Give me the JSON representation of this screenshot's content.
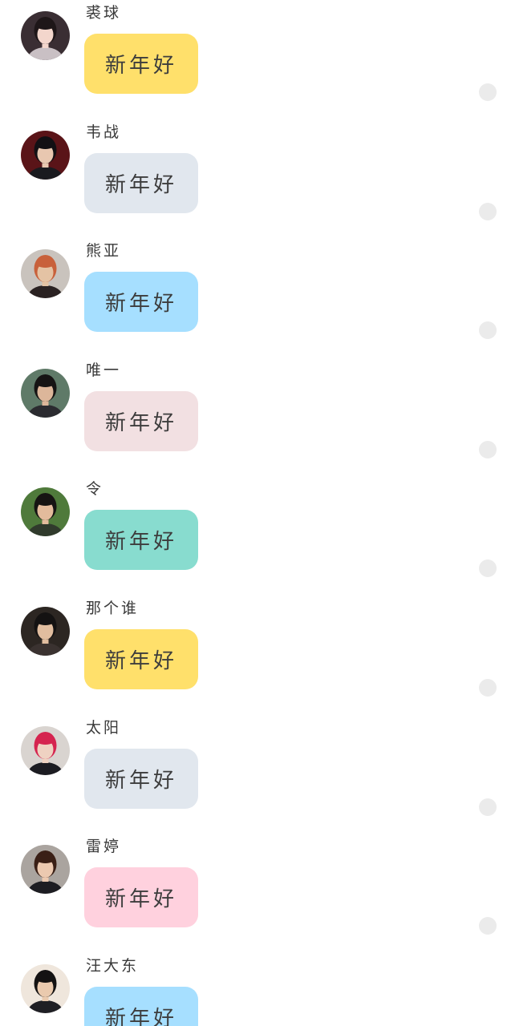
{
  "messages": [
    {
      "name": "裘球",
      "text": "新年好",
      "bubble_color": "#ffe06b",
      "avatar": {
        "bg": "#3a2e33",
        "face": "#f3d6cc",
        "hair": "#1e1618",
        "shirt": "#c9c0c4"
      }
    },
    {
      "name": "韦战",
      "text": "新年好",
      "bubble_color": "#e1e7ee",
      "avatar": {
        "bg": "#5a1418",
        "face": "#e8c7b0",
        "hair": "#121014",
        "shirt": "#1a1a1f"
      }
    },
    {
      "name": "熊亚",
      "text": "新年好",
      "bubble_color": "#a6dfff",
      "avatar": {
        "bg": "#c9c3bd",
        "face": "#e4c3a4",
        "hair": "#c8613b",
        "shirt": "#2a2222"
      }
    },
    {
      "name": "唯一",
      "text": "新年好",
      "bubble_color": "#f2e0e2",
      "avatar": {
        "bg": "#5f7a68",
        "face": "#dcb69a",
        "hair": "#161414",
        "shirt": "#2b2b30"
      }
    },
    {
      "name": "令",
      "text": "新年好",
      "bubble_color": "#88dccf",
      "avatar": {
        "bg": "#4f7a3b",
        "face": "#e3bb9c",
        "hair": "#161413",
        "shirt": "#303a2c"
      }
    },
    {
      "name": "那个谁",
      "text": "新年好",
      "bubble_color": "#ffe06b",
      "avatar": {
        "bg": "#2c2622",
        "face": "#e1bd9f",
        "hair": "#141212",
        "shirt": "#3a3230"
      }
    },
    {
      "name": "太阳",
      "text": "新年好",
      "bubble_color": "#e1e7ee",
      "avatar": {
        "bg": "#d9d4d0",
        "face": "#efd2c2",
        "hair": "#d5244f",
        "shirt": "#1c1c22"
      }
    },
    {
      "name": "雷婷",
      "text": "新年好",
      "bubble_color": "#ffd1de",
      "avatar": {
        "bg": "#aaa49f",
        "face": "#ecc9b0",
        "hair": "#3a1f16",
        "shirt": "#1d1d22"
      }
    },
    {
      "name": "汪大东",
      "text": "新年好",
      "bubble_color": "#a6dfff",
      "avatar": {
        "bg": "#efe6dc",
        "face": "#eacaae",
        "hair": "#141212",
        "shirt": "#1f1f24"
      }
    }
  ]
}
